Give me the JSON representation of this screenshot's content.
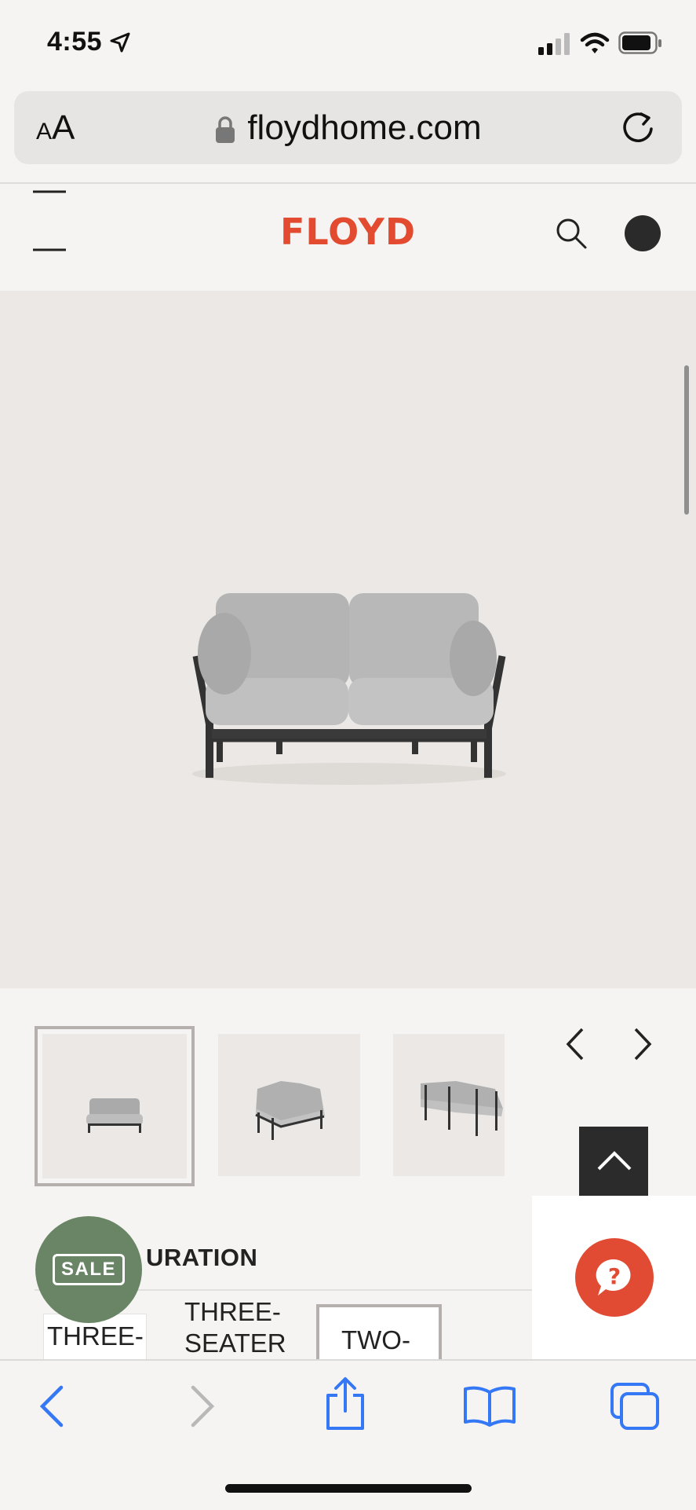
{
  "status_bar": {
    "time": "4:55"
  },
  "browser": {
    "text_size_label_small": "A",
    "text_size_label_large": "A",
    "url": "floydhome.com"
  },
  "site": {
    "logo": "FLOYD",
    "brand_color": "#e34b30"
  },
  "product": {
    "section_title_partial": "URATION",
    "sale_badge": "SALE",
    "options": [
      {
        "label": "THREE-",
        "selected": false
      },
      {
        "label": "THREE-\nSEATER",
        "selected": false
      },
      {
        "label": "TWO-",
        "selected": true
      }
    ]
  },
  "colors": {
    "hero_bg": "#ebe8e5",
    "sale_green": "#6a8566",
    "help_red": "#e24b33",
    "safari_blue": "#3478f6"
  },
  "icons": [
    "location-arrow-icon",
    "signal-icon",
    "wifi-icon",
    "battery-icon",
    "lock-icon",
    "reload-icon",
    "menu-icon",
    "search-icon",
    "account-icon",
    "chevron-left-icon",
    "chevron-right-icon",
    "chevron-up-icon",
    "help-icon",
    "back-icon",
    "forward-icon",
    "share-icon",
    "bookmarks-icon",
    "tabs-icon"
  ]
}
